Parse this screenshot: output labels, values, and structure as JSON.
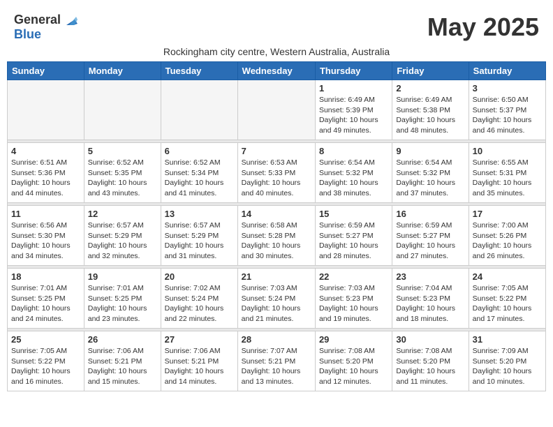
{
  "header": {
    "logo_general": "General",
    "logo_blue": "Blue",
    "month_title": "May 2025",
    "subtitle": "Rockingham city centre, Western Australia, Australia"
  },
  "days_of_week": [
    "Sunday",
    "Monday",
    "Tuesday",
    "Wednesday",
    "Thursday",
    "Friday",
    "Saturday"
  ],
  "weeks": [
    {
      "days": [
        {
          "num": "",
          "empty": true
        },
        {
          "num": "",
          "empty": true
        },
        {
          "num": "",
          "empty": true
        },
        {
          "num": "",
          "empty": true
        },
        {
          "num": "1",
          "sunrise": "6:49 AM",
          "sunset": "5:39 PM",
          "daylight": "10 hours and 49 minutes."
        },
        {
          "num": "2",
          "sunrise": "6:49 AM",
          "sunset": "5:38 PM",
          "daylight": "10 hours and 48 minutes."
        },
        {
          "num": "3",
          "sunrise": "6:50 AM",
          "sunset": "5:37 PM",
          "daylight": "10 hours and 46 minutes."
        }
      ]
    },
    {
      "days": [
        {
          "num": "4",
          "sunrise": "6:51 AM",
          "sunset": "5:36 PM",
          "daylight": "10 hours and 44 minutes."
        },
        {
          "num": "5",
          "sunrise": "6:52 AM",
          "sunset": "5:35 PM",
          "daylight": "10 hours and 43 minutes."
        },
        {
          "num": "6",
          "sunrise": "6:52 AM",
          "sunset": "5:34 PM",
          "daylight": "10 hours and 41 minutes."
        },
        {
          "num": "7",
          "sunrise": "6:53 AM",
          "sunset": "5:33 PM",
          "daylight": "10 hours and 40 minutes."
        },
        {
          "num": "8",
          "sunrise": "6:54 AM",
          "sunset": "5:32 PM",
          "daylight": "10 hours and 38 minutes."
        },
        {
          "num": "9",
          "sunrise": "6:54 AM",
          "sunset": "5:32 PM",
          "daylight": "10 hours and 37 minutes."
        },
        {
          "num": "10",
          "sunrise": "6:55 AM",
          "sunset": "5:31 PM",
          "daylight": "10 hours and 35 minutes."
        }
      ]
    },
    {
      "days": [
        {
          "num": "11",
          "sunrise": "6:56 AM",
          "sunset": "5:30 PM",
          "daylight": "10 hours and 34 minutes."
        },
        {
          "num": "12",
          "sunrise": "6:57 AM",
          "sunset": "5:29 PM",
          "daylight": "10 hours and 32 minutes."
        },
        {
          "num": "13",
          "sunrise": "6:57 AM",
          "sunset": "5:29 PM",
          "daylight": "10 hours and 31 minutes."
        },
        {
          "num": "14",
          "sunrise": "6:58 AM",
          "sunset": "5:28 PM",
          "daylight": "10 hours and 30 minutes."
        },
        {
          "num": "15",
          "sunrise": "6:59 AM",
          "sunset": "5:27 PM",
          "daylight": "10 hours and 28 minutes."
        },
        {
          "num": "16",
          "sunrise": "6:59 AM",
          "sunset": "5:27 PM",
          "daylight": "10 hours and 27 minutes."
        },
        {
          "num": "17",
          "sunrise": "7:00 AM",
          "sunset": "5:26 PM",
          "daylight": "10 hours and 26 minutes."
        }
      ]
    },
    {
      "days": [
        {
          "num": "18",
          "sunrise": "7:01 AM",
          "sunset": "5:25 PM",
          "daylight": "10 hours and 24 minutes."
        },
        {
          "num": "19",
          "sunrise": "7:01 AM",
          "sunset": "5:25 PM",
          "daylight": "10 hours and 23 minutes."
        },
        {
          "num": "20",
          "sunrise": "7:02 AM",
          "sunset": "5:24 PM",
          "daylight": "10 hours and 22 minutes."
        },
        {
          "num": "21",
          "sunrise": "7:03 AM",
          "sunset": "5:24 PM",
          "daylight": "10 hours and 21 minutes."
        },
        {
          "num": "22",
          "sunrise": "7:03 AM",
          "sunset": "5:23 PM",
          "daylight": "10 hours and 19 minutes."
        },
        {
          "num": "23",
          "sunrise": "7:04 AM",
          "sunset": "5:23 PM",
          "daylight": "10 hours and 18 minutes."
        },
        {
          "num": "24",
          "sunrise": "7:05 AM",
          "sunset": "5:22 PM",
          "daylight": "10 hours and 17 minutes."
        }
      ]
    },
    {
      "days": [
        {
          "num": "25",
          "sunrise": "7:05 AM",
          "sunset": "5:22 PM",
          "daylight": "10 hours and 16 minutes."
        },
        {
          "num": "26",
          "sunrise": "7:06 AM",
          "sunset": "5:21 PM",
          "daylight": "10 hours and 15 minutes."
        },
        {
          "num": "27",
          "sunrise": "7:06 AM",
          "sunset": "5:21 PM",
          "daylight": "10 hours and 14 minutes."
        },
        {
          "num": "28",
          "sunrise": "7:07 AM",
          "sunset": "5:21 PM",
          "daylight": "10 hours and 13 minutes."
        },
        {
          "num": "29",
          "sunrise": "7:08 AM",
          "sunset": "5:20 PM",
          "daylight": "10 hours and 12 minutes."
        },
        {
          "num": "30",
          "sunrise": "7:08 AM",
          "sunset": "5:20 PM",
          "daylight": "10 hours and 11 minutes."
        },
        {
          "num": "31",
          "sunrise": "7:09 AM",
          "sunset": "5:20 PM",
          "daylight": "10 hours and 10 minutes."
        }
      ]
    }
  ],
  "labels": {
    "sunrise": "Sunrise:",
    "sunset": "Sunset:",
    "daylight": "Daylight:"
  }
}
